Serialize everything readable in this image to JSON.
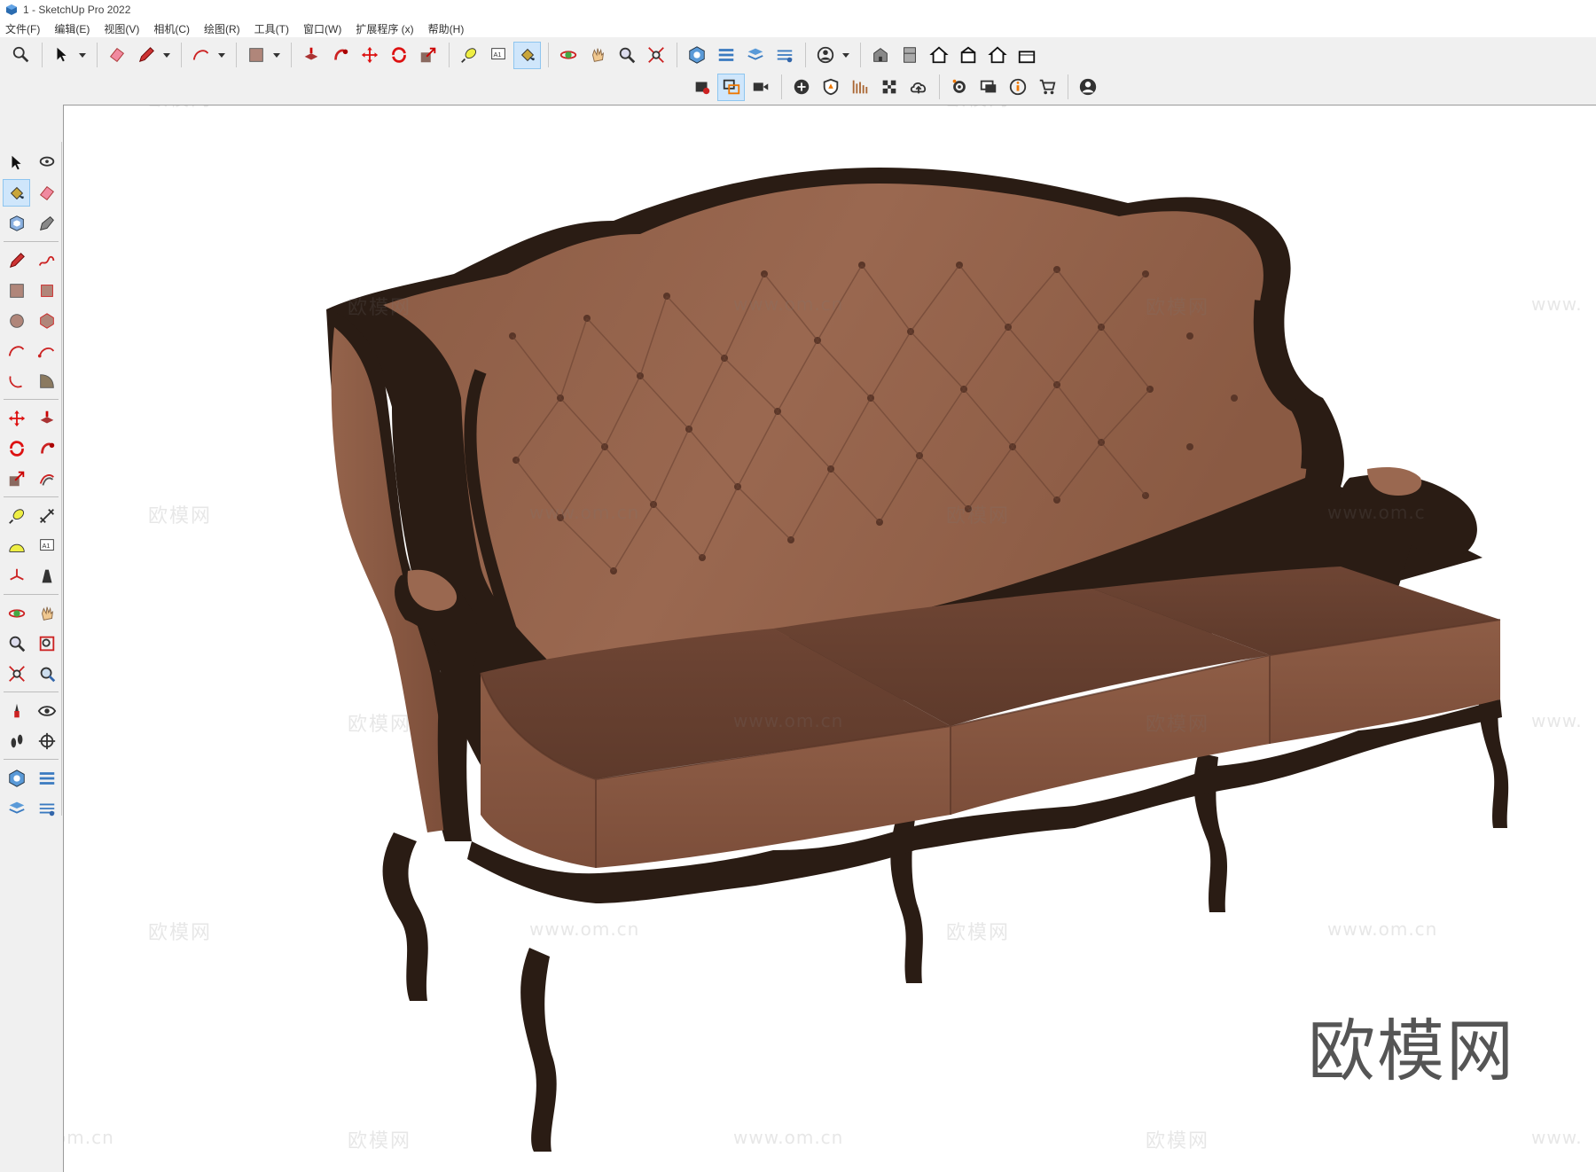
{
  "window": {
    "title": "1 - SketchUp Pro 2022"
  },
  "menu": [
    "文件(F)",
    "编辑(E)",
    "视图(V)",
    "相机(C)",
    "绘图(R)",
    "工具(T)",
    "窗口(W)",
    "扩展程序 (x)",
    "帮助(H)"
  ],
  "toolbar_row1": [
    {
      "name": "search-tool",
      "icon": "search-icon"
    },
    {
      "name": "select-tool",
      "icon": "arrow-icon",
      "dropdown": true
    },
    {
      "name": "eraser-tool",
      "icon": "eraser-icon"
    },
    {
      "name": "pencil-tool",
      "icon": "pencil-icon",
      "dropdown": true
    },
    {
      "name": "arc-tool",
      "icon": "arc-icon",
      "dropdown": true
    },
    {
      "name": "rectangle-tool",
      "icon": "rectangle-icon",
      "dropdown": true
    },
    {
      "name": "push-pull-tool",
      "icon": "push-pull-icon"
    },
    {
      "name": "follow-me-tool",
      "icon": "follow-me-icon"
    },
    {
      "name": "move-tool",
      "icon": "move-icon"
    },
    {
      "name": "rotate-tool",
      "icon": "rotate-icon"
    },
    {
      "name": "scale-tool",
      "icon": "scale-icon"
    },
    {
      "name": "tape-measure-tool",
      "icon": "tape-icon"
    },
    {
      "name": "text-tool",
      "icon": "text-icon",
      "label": "A1"
    },
    {
      "name": "paint-bucket-tool",
      "icon": "paint-bucket-icon",
      "active": true
    },
    {
      "name": "orbit-tool",
      "icon": "orbit-icon"
    },
    {
      "name": "pan-tool",
      "icon": "hand-icon"
    },
    {
      "name": "zoom-tool",
      "icon": "zoom-icon"
    },
    {
      "name": "zoom-extents-tool",
      "icon": "zoom-extents-icon"
    },
    {
      "name": "warehouse-tool",
      "icon": "warehouse-icon"
    },
    {
      "name": "extension-warehouse-tool",
      "icon": "extension-icon"
    },
    {
      "name": "layout-tool",
      "icon": "layers-icon"
    },
    {
      "name": "share-tool",
      "icon": "share-icon"
    },
    {
      "name": "account-tool",
      "icon": "account-icon",
      "dropdown": true
    },
    {
      "name": "iso-view",
      "icon": "iso-house-icon"
    },
    {
      "name": "top-view",
      "icon": "top-view-icon"
    },
    {
      "name": "front-view",
      "icon": "front-house-icon"
    },
    {
      "name": "right-view",
      "icon": "right-house-icon"
    },
    {
      "name": "back-view",
      "icon": "back-house-icon"
    },
    {
      "name": "left-view",
      "icon": "left-house-icon"
    }
  ],
  "toolbar_row2": [
    {
      "name": "style-builder",
      "icon": "styles-icon"
    },
    {
      "name": "section-plane",
      "icon": "section-icon",
      "active": true
    },
    {
      "name": "video-camera",
      "icon": "camera-icon"
    },
    {
      "name": "add-location",
      "icon": "plus-circle-icon"
    },
    {
      "name": "shield-extension",
      "icon": "shield-icon"
    },
    {
      "name": "sandbox-tool",
      "icon": "sandbox-icon"
    },
    {
      "name": "checker-tool",
      "icon": "checker-icon"
    },
    {
      "name": "cloud-upload",
      "icon": "cloud-icon"
    },
    {
      "name": "extension-manager",
      "icon": "gear-icon"
    },
    {
      "name": "chat-tool",
      "icon": "chat-icon"
    },
    {
      "name": "info-tool",
      "icon": "info-icon"
    },
    {
      "name": "cart-tool",
      "icon": "cart-icon"
    },
    {
      "name": "profile-tool",
      "icon": "profile-icon"
    }
  ],
  "left_toolbar": [
    {
      "name": "select",
      "icon": "arrow-icon"
    },
    {
      "name": "lasso",
      "icon": "lasso-icon"
    },
    {
      "name": "paint-bucket",
      "icon": "paint-bucket-icon",
      "active": true
    },
    {
      "name": "eraser",
      "icon": "eraser-icon"
    },
    {
      "name": "make-component",
      "icon": "component-icon"
    },
    {
      "name": "tag-tool",
      "icon": "tag-icon"
    },
    {
      "name": "line",
      "icon": "pencil-icon"
    },
    {
      "name": "freehand",
      "icon": "freehand-icon"
    },
    {
      "name": "rectangle",
      "icon": "rectangle-icon"
    },
    {
      "name": "rotated-rectangle",
      "icon": "rotated-rectangle-icon"
    },
    {
      "name": "circle",
      "icon": "circle-icon"
    },
    {
      "name": "polygon",
      "icon": "polygon-icon"
    },
    {
      "name": "arc",
      "icon": "arc-icon"
    },
    {
      "name": "two-point-arc",
      "icon": "arc2-icon"
    },
    {
      "name": "three-point-arc",
      "icon": "arc3-icon"
    },
    {
      "name": "pie",
      "icon": "pie-icon"
    },
    {
      "name": "move",
      "icon": "move-icon"
    },
    {
      "name": "push-pull",
      "icon": "push-pull-icon"
    },
    {
      "name": "rotate",
      "icon": "rotate-icon"
    },
    {
      "name": "follow-me",
      "icon": "follow-me-icon"
    },
    {
      "name": "scale",
      "icon": "scale-icon"
    },
    {
      "name": "offset",
      "icon": "offset-icon"
    },
    {
      "name": "tape-measure",
      "icon": "tape-icon"
    },
    {
      "name": "dimension",
      "icon": "dimension-icon"
    },
    {
      "name": "protractor",
      "icon": "protractor-icon"
    },
    {
      "name": "text",
      "icon": "text-icon",
      "label": "A1"
    },
    {
      "name": "axes",
      "icon": "axes-icon"
    },
    {
      "name": "3d-text",
      "icon": "3d-text-icon"
    },
    {
      "name": "orbit",
      "icon": "orbit-icon"
    },
    {
      "name": "pan",
      "icon": "hand-icon"
    },
    {
      "name": "zoom",
      "icon": "zoom-icon"
    },
    {
      "name": "zoom-window",
      "icon": "zoom-window-icon"
    },
    {
      "name": "zoom-extents",
      "icon": "zoom-extents-icon"
    },
    {
      "name": "previous-view",
      "icon": "previous-view-icon"
    },
    {
      "name": "position-camera",
      "icon": "position-camera-icon"
    },
    {
      "name": "look-around",
      "icon": "eye-icon"
    },
    {
      "name": "walk",
      "icon": "footprints-icon"
    },
    {
      "name": "section",
      "icon": "section-plane-icon"
    },
    {
      "name": "warehouse",
      "icon": "warehouse-icon"
    },
    {
      "name": "extension-warehouse",
      "icon": "extension-icon"
    },
    {
      "name": "layout",
      "icon": "layers-icon"
    },
    {
      "name": "share",
      "icon": "share-icon"
    }
  ],
  "watermarks": {
    "brand": "欧模网",
    "url": "www.om.cn",
    "url_partial_left": "om.cn",
    "url_partial_right": "www.",
    "url_partial_mid": "www.om.c"
  },
  "colors": {
    "fabric": "#8a5a43",
    "fabric_dark": "#6a4030",
    "wood": "#2a1c14",
    "active_bg": "#cfe6fb"
  }
}
